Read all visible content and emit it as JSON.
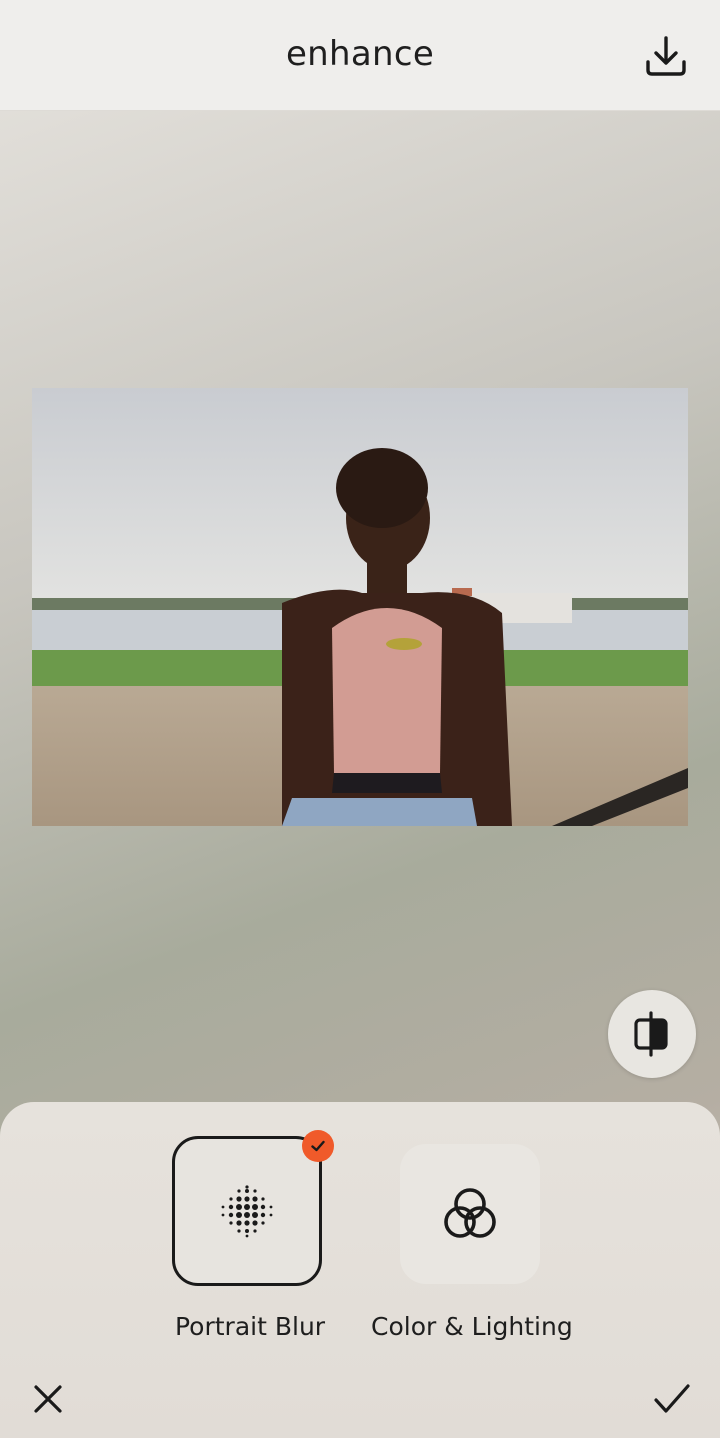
{
  "header": {
    "title": "enhance",
    "download_icon": "download-icon"
  },
  "photo": {
    "description_icon": "photo-preview"
  },
  "compare": {
    "icon": "compare-icon"
  },
  "tools": [
    {
      "label": "Portrait Blur",
      "icon": "dot-grid-icon",
      "selected": true
    },
    {
      "label": "Color & Lighting",
      "icon": "interlocking-circles-icon",
      "selected": false
    }
  ],
  "footer": {
    "cancel_icon": "close-icon",
    "confirm_icon": "checkmark-icon"
  },
  "colors": {
    "accent": "#f05a2a",
    "text": "#1e1e1e",
    "header_bg": "#efeeec"
  }
}
